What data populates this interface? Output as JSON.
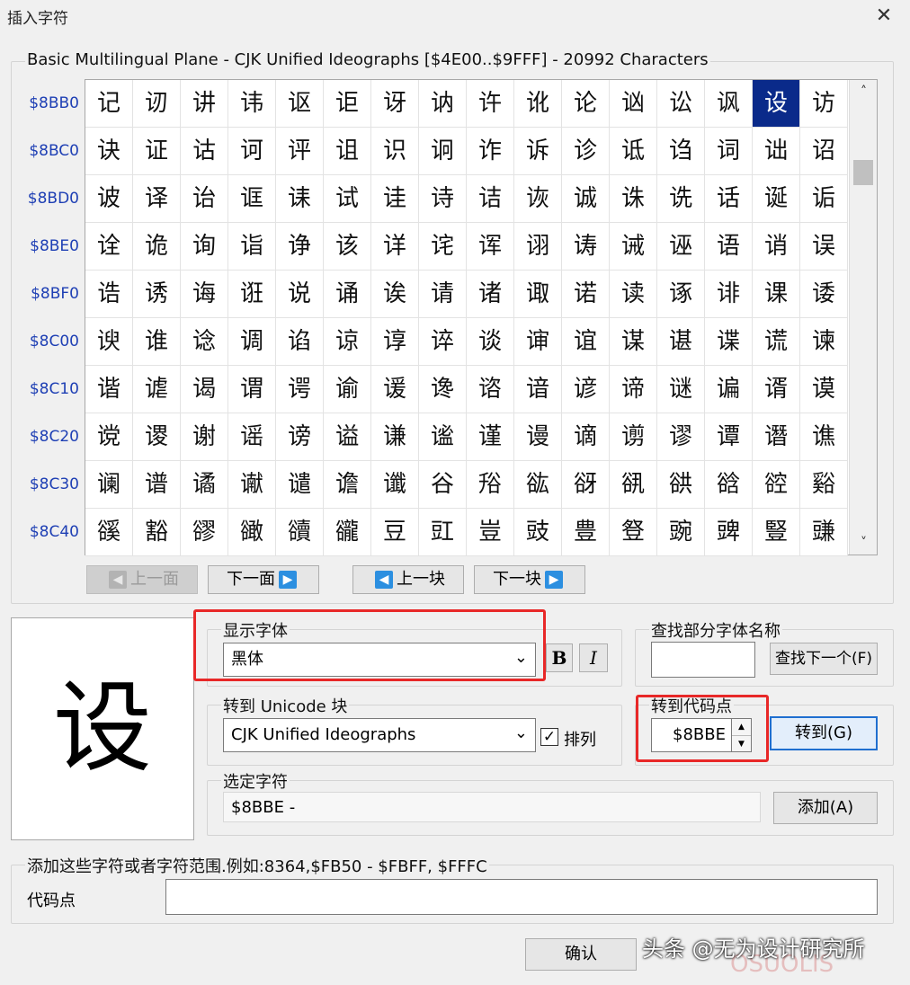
{
  "window": {
    "title": "插入字符",
    "close_glyph": "✕"
  },
  "block_header": "Basic Multilingual Plane - CJK Unified Ideographs [$4E00..$9FFF] - 20992 Characters",
  "grid": {
    "rows": [
      {
        "code": "$8BB0",
        "chars": [
          "记",
          "讱",
          "讲",
          "讳",
          "讴",
          "讵",
          "讶",
          "讷",
          "许",
          "讹",
          "论",
          "讻",
          "讼",
          "讽",
          "设",
          "访"
        ]
      },
      {
        "code": "$8BC0",
        "chars": [
          "诀",
          "证",
          "诂",
          "诃",
          "评",
          "诅",
          "识",
          "诇",
          "诈",
          "诉",
          "诊",
          "诋",
          "诌",
          "词",
          "诎",
          "诏"
        ]
      },
      {
        "code": "$8BD0",
        "chars": [
          "诐",
          "译",
          "诒",
          "诓",
          "诔",
          "试",
          "诖",
          "诗",
          "诘",
          "诙",
          "诚",
          "诛",
          "诜",
          "话",
          "诞",
          "诟"
        ]
      },
      {
        "code": "$8BE0",
        "chars": [
          "诠",
          "诡",
          "询",
          "诣",
          "诤",
          "该",
          "详",
          "诧",
          "诨",
          "诩",
          "诪",
          "诫",
          "诬",
          "语",
          "诮",
          "误"
        ]
      },
      {
        "code": "$8BF0",
        "chars": [
          "诰",
          "诱",
          "诲",
          "诳",
          "说",
          "诵",
          "诶",
          "请",
          "诸",
          "诹",
          "诺",
          "读",
          "诼",
          "诽",
          "课",
          "诿"
        ]
      },
      {
        "code": "$8C00",
        "chars": [
          "谀",
          "谁",
          "谂",
          "调",
          "谄",
          "谅",
          "谆",
          "谇",
          "谈",
          "谉",
          "谊",
          "谋",
          "谌",
          "谍",
          "谎",
          "谏"
        ]
      },
      {
        "code": "$8C10",
        "chars": [
          "谐",
          "谑",
          "谒",
          "谓",
          "谔",
          "谕",
          "谖",
          "谗",
          "谘",
          "谙",
          "谚",
          "谛",
          "谜",
          "谝",
          "谞",
          "谟"
        ]
      },
      {
        "code": "$8C20",
        "chars": [
          "谠",
          "谡",
          "谢",
          "谣",
          "谤",
          "谥",
          "谦",
          "谧",
          "谨",
          "谩",
          "谪",
          "谫",
          "谬",
          "谭",
          "谮",
          "谯"
        ]
      },
      {
        "code": "$8C30",
        "chars": [
          "谰",
          "谱",
          "谲",
          "谳",
          "谴",
          "谵",
          "谶",
          "谷",
          "谸",
          "谹",
          "谺",
          "谻",
          "谼",
          "谽",
          "谾",
          "谿"
        ]
      },
      {
        "code": "$8C40",
        "chars": [
          "豀",
          "豁",
          "豂",
          "豃",
          "豄",
          "豅",
          "豆",
          "豇",
          "豈",
          "豉",
          "豊",
          "豋",
          "豌",
          "豍",
          "豎",
          "豏"
        ]
      }
    ],
    "selected_row": 0,
    "selected_col": 14,
    "scroll_up": "˄",
    "scroll_down": "˅"
  },
  "nav": {
    "prev_page": "上一面",
    "next_page": "下一面",
    "prev_block": "上一块",
    "next_block": "下一块",
    "left_arrow": "◀",
    "right_arrow": "▶"
  },
  "preview": {
    "char": "设"
  },
  "font_display": {
    "label": "显示字体",
    "value": "黑体",
    "bold": "B",
    "italic": "I",
    "dropdown_arrow": "⌄"
  },
  "find_font": {
    "label": "查找部分字体名称",
    "value": "",
    "button": "查找下一个(F)"
  },
  "unicode_block": {
    "label": "转到 Unicode 块",
    "value": "CJK Unified Ideographs",
    "sort_checked": true,
    "sort_label": "排列",
    "check_mark": "✓"
  },
  "goto_code": {
    "label": "转到代码点",
    "value": "$8BBE",
    "spin_up": "▲",
    "spin_down": "▼",
    "button": "转到(G)"
  },
  "selected_chars": {
    "label": "选定字符",
    "value": "$8BBE -",
    "add_button": "添加(A)"
  },
  "add_range": {
    "label": "添加这些字符或者字符范围.例如:8364,$FB50 - $FBFF, $FFFC",
    "code_label": "代码点",
    "value": ""
  },
  "footer": {
    "ok_button": "确认"
  },
  "watermark": "头条 @无为设计研究所",
  "watermark_faint": "OSUOLIS"
}
